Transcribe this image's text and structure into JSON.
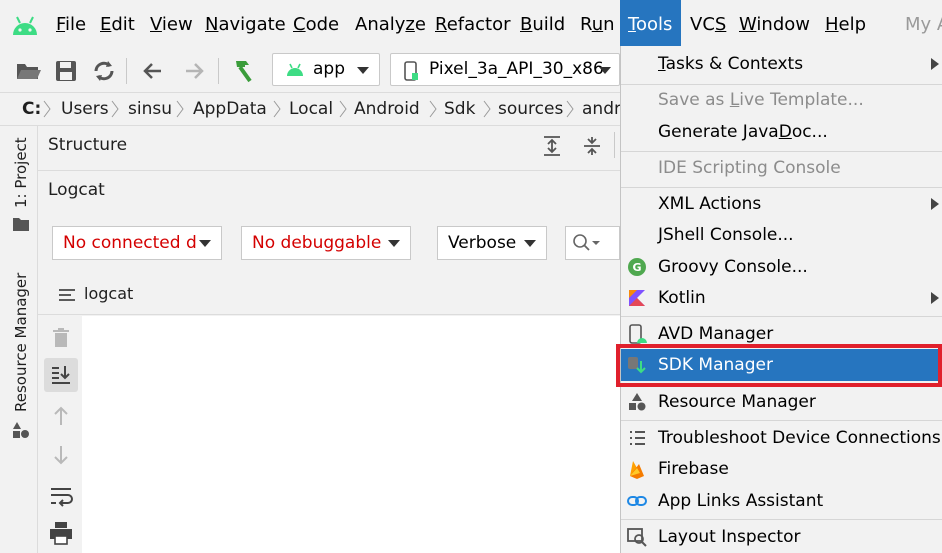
{
  "menubar": {
    "items": [
      {
        "mn": "F",
        "rest": "ile"
      },
      {
        "mn": "E",
        "rest": "dit"
      },
      {
        "mn": "V",
        "rest": "iew"
      },
      {
        "mn": "N",
        "rest": "avigate"
      },
      {
        "mn": "C",
        "rest": "ode"
      },
      {
        "pre": "Analy",
        "mn": "z",
        "rest": "e"
      },
      {
        "mn": "R",
        "rest": "efactor"
      },
      {
        "mn": "B",
        "rest": "uild"
      },
      {
        "pre": "R",
        "mn": "u",
        "rest": "n"
      },
      {
        "mn": "T",
        "rest": "ools"
      },
      {
        "pre": "VC",
        "mn": "S",
        "rest": ""
      },
      {
        "mn": "W",
        "rest": "indow"
      },
      {
        "mn": "H",
        "rest": "elp"
      }
    ],
    "project_name": "My A"
  },
  "toolbar": {
    "run_config": "app",
    "device": "Pixel_3a_API_30_x86"
  },
  "breadcrumb": [
    "C:",
    "Users",
    "sinsu",
    "AppData",
    "Local",
    "Android",
    "Sdk",
    "sources",
    "andr"
  ],
  "left_stripe": {
    "project_tab": "1: Project",
    "resource_tab": "Resource Manager"
  },
  "panel": {
    "structure_title": "Structure",
    "logcat_title": "Logcat",
    "device_filter": "No connected d",
    "process_filter": "No debuggable",
    "log_level": "Verbose",
    "logcat_tab": "logcat"
  },
  "tools_menu": {
    "tasks": {
      "pre": "",
      "mn": "T",
      "rest": "asks & Contexts"
    },
    "save_template": {
      "pre": "Save as ",
      "mn": "L",
      "rest": "ive Template..."
    },
    "generate_javadoc": {
      "pre": "Generate Java",
      "mn": "D",
      "rest": "oc..."
    },
    "ide_scripting": "IDE Scripting Console",
    "xml_actions": "XML Actions",
    "jshell": "JShell Console...",
    "groovy": "Groovy Console...",
    "kotlin": "Kotlin",
    "avd_manager": "AVD Manager",
    "sdk_manager": "SDK Manager",
    "resource_manager": "Resource Manager",
    "troubleshoot": "Troubleshoot Device Connections",
    "firebase": "Firebase",
    "app_links": "App Links Assistant",
    "layout_inspector": "Layout Inspector"
  },
  "colors": {
    "selection": "#2675bf",
    "highlight_border": "#e0202c",
    "android_green": "#3ddc84",
    "filter_red": "#d40000"
  }
}
